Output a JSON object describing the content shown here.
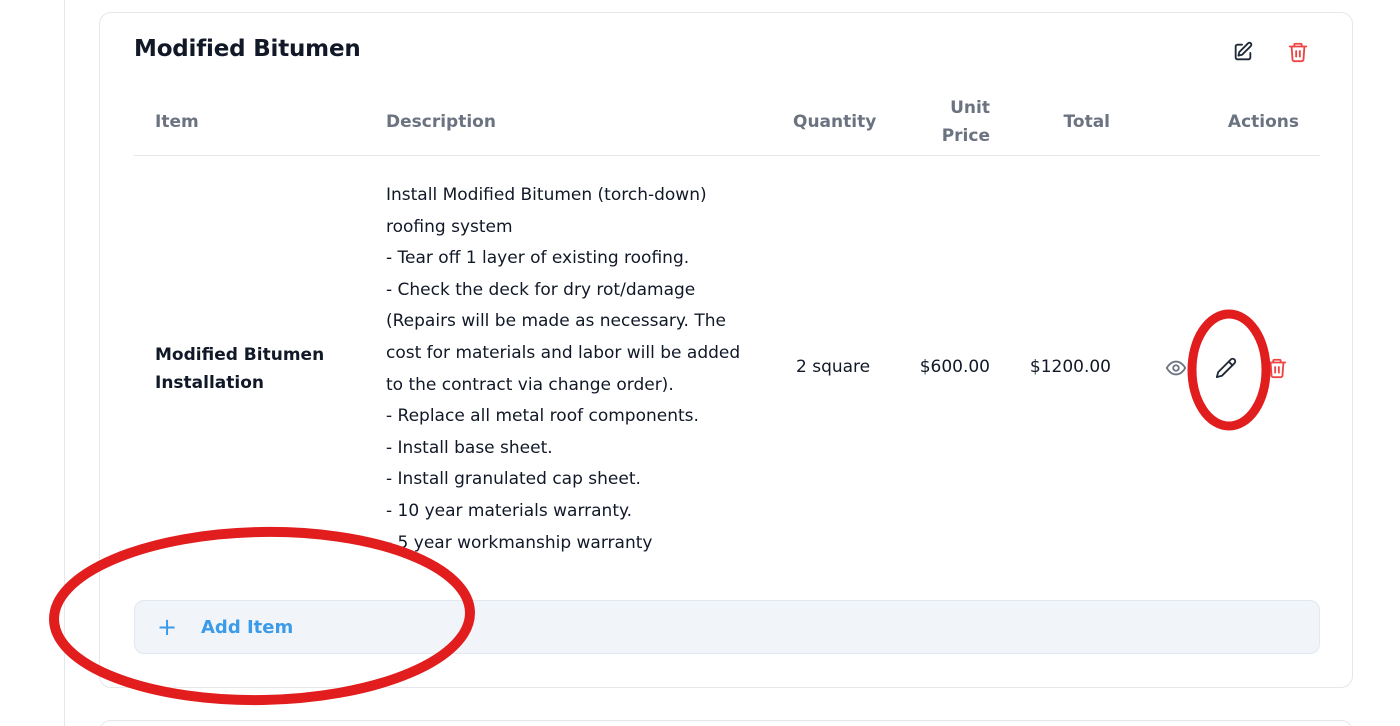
{
  "section": {
    "title": "Modified Bitumen",
    "edit_icon": "edit-square-icon",
    "delete_icon": "trash-icon"
  },
  "table": {
    "headers": {
      "item": "Item",
      "description": "Description",
      "quantity": "Quantity",
      "unit_price_line1": "Unit",
      "unit_price_line2": "Price",
      "total": "Total",
      "actions": "Actions"
    },
    "rows": [
      {
        "item_line1": "Modified Bitumen",
        "item_line2": "Installation",
        "description_lines": [
          "Install Modified Bitumen (torch-down)",
          "roofing system",
          "- Tear off 1 layer of existing roofing.",
          "- Check the deck for dry rot/damage",
          "(Repairs will be made as necessary. The",
          "cost for materials and labor will be added",
          "to the contract via change order).",
          "- Replace all metal roof components.",
          "- Install base sheet.",
          "- Install granulated cap sheet.",
          "- 10 year materials warranty.",
          "- 5 year workmanship warranty"
        ],
        "quantity": "2 square",
        "unit_price": "$600.00",
        "total": "$1200.00",
        "action_icons": [
          "eye-icon",
          "pencil-icon",
          "trash-icon"
        ]
      }
    ]
  },
  "add_item": {
    "icon": "plus-icon",
    "label": "Add Item"
  },
  "colors": {
    "accent_blue": "#3b9be8",
    "danger_red": "#ef4444",
    "annotation_red": "#e11d1d"
  }
}
